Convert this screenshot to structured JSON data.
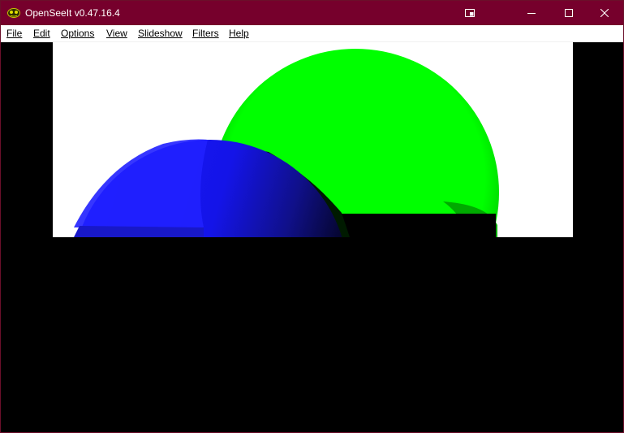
{
  "window": {
    "title": "OpenSeeIt v0.47.16.4",
    "accent_color": "#76002c"
  },
  "titlebar": {
    "icon": "app-logo-icon",
    "extra_icon": "window-snap-icon",
    "buttons": [
      {
        "name": "minimize",
        "icon": "minimize-icon"
      },
      {
        "name": "maximize",
        "icon": "maximize-icon"
      },
      {
        "name": "close",
        "icon": "close-icon"
      }
    ]
  },
  "menu": {
    "items": [
      "File",
      "Edit",
      "Options",
      "View",
      "Slideshow",
      "Filters",
      "Help"
    ]
  },
  "viewer": {
    "background": "#000000",
    "image_colors": {
      "sphere_green": "#00ff00",
      "sphere_blue": "#1a1aff",
      "backdrop": "#ffffff"
    }
  }
}
